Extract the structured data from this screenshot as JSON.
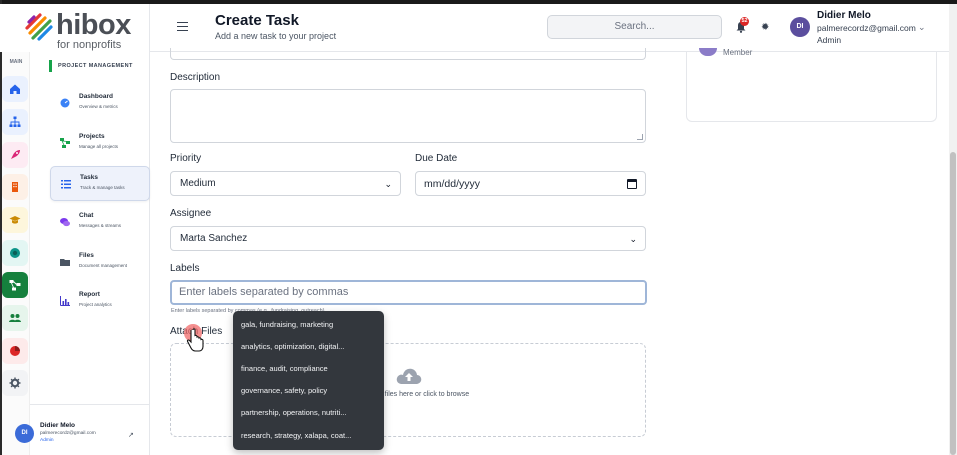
{
  "brand": {
    "name": "hibox",
    "tagline": "for nonprofits"
  },
  "rail": {
    "section_label": "MAIN",
    "items": [
      {
        "icon": "home-icon",
        "color": "#2563eb",
        "bg": "#eaf1fe"
      },
      {
        "icon": "sitemap-icon",
        "color": "#2563eb",
        "bg": "#eaf1fe"
      },
      {
        "icon": "rocket-icon",
        "color": "#db2777",
        "bg": "#fdebf3"
      },
      {
        "icon": "building-icon",
        "color": "#ea580c",
        "bg": "#fdf0e6"
      },
      {
        "icon": "graduation-cap-icon",
        "color": "#ca8a04",
        "bg": "#fdf6dc"
      },
      {
        "icon": "circle-dot-icon",
        "color": "#0d9488",
        "bg": "#e3f6f3"
      },
      {
        "icon": "project-diagram-icon",
        "color": "#ffffff",
        "bg": "#15803d"
      },
      {
        "icon": "people-icon",
        "color": "#15803d",
        "bg": "#e6f5ec"
      },
      {
        "icon": "pie-chart-icon",
        "color": "#dc2626",
        "bg": "#fdeaea"
      },
      {
        "icon": "gear-icon",
        "color": "#4b5563",
        "bg": "#f2f3f5"
      }
    ]
  },
  "sidebar": {
    "section": "PROJECT MANAGEMENT",
    "items": [
      {
        "title": "Dashboard",
        "subtitle": "Overview & metrics"
      },
      {
        "title": "Projects",
        "subtitle": "Manage all projects"
      },
      {
        "title": "Tasks",
        "subtitle": "Track & manage tasks"
      },
      {
        "title": "Chat",
        "subtitle": "Messages & streams"
      },
      {
        "title": "Files",
        "subtitle": "Document management"
      },
      {
        "title": "Report",
        "subtitle": "Project analytics"
      }
    ],
    "profile": {
      "initials": "DI",
      "name": "Didier Melo",
      "email": "palmerecordz@gmail.com",
      "role": "Admin"
    }
  },
  "header": {
    "title": "Create Task",
    "subtitle": "Add a new task to your project",
    "search_placeholder": "Search...",
    "notification_count": "52",
    "user": {
      "initials": "DI",
      "name": "Didier Melo",
      "email": "palmerecordz@gmail.com",
      "role": "Admin"
    }
  },
  "form": {
    "description_label": "Description",
    "priority_label": "Priority",
    "priority_value": "Medium",
    "due_date_label": "Due Date",
    "due_date_placeholder": "mm/dd/yyyy",
    "assignee_label": "Assignee",
    "assignee_value": "Marta Sanchez",
    "labels_label": "Labels",
    "labels_placeholder": "Enter labels separated by commas",
    "labels_hint": "Enter labels separated by commas (e.g., fundraising, outreach)",
    "attach_label": "Attach Files",
    "drop_text": "Drag and drop files here or click to browse"
  },
  "suggestions": [
    "gala, fundraising, marketing",
    "analytics, optimization, digital...",
    "finance, audit, compliance",
    "governance, safety, policy",
    "partnership, operations, nutriti...",
    "research, strategy, xalapa, coat..."
  ],
  "side_card": {
    "member_label": "Member"
  }
}
